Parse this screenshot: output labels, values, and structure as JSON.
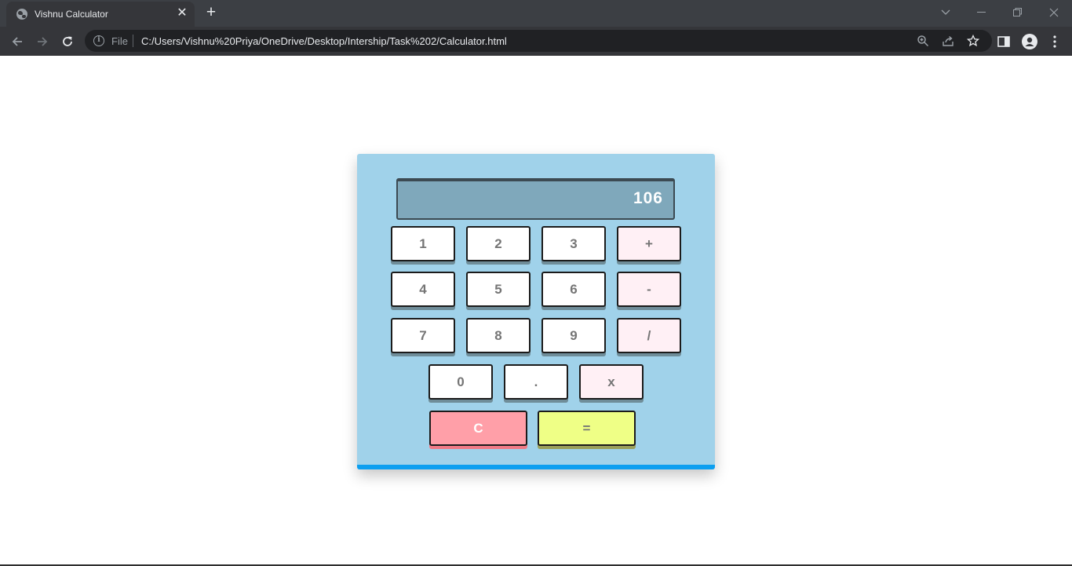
{
  "browser": {
    "tab_title": "Vishnu Calculator",
    "tab_close": "✕",
    "new_tab": "+",
    "scheme_label": "File",
    "url": "C:/Users/Vishnu%20Priya/OneDrive/Desktop/Intership/Task%202/Calculator.html",
    "theme_colors": {
      "titlebar": "#3c3f44",
      "toolbar": "#35363a",
      "omnibox": "#202124"
    }
  },
  "calculator": {
    "display_value": "106",
    "rows": [
      [
        "1",
        "2",
        "3",
        "+"
      ],
      [
        "4",
        "5",
        "6",
        "-"
      ],
      [
        "7",
        "8",
        "9",
        "/"
      ],
      [
        "0",
        ".",
        "x"
      ],
      [
        "C",
        "="
      ]
    ],
    "colors": {
      "body": "#a0d2ea",
      "accent_border": "#0c9ff0",
      "display": "#7fa8bb",
      "key": "#ffffff",
      "operator_key": "#fff0f5",
      "clear_key": "#ff9fa8",
      "equals_key": "#efff86"
    }
  }
}
